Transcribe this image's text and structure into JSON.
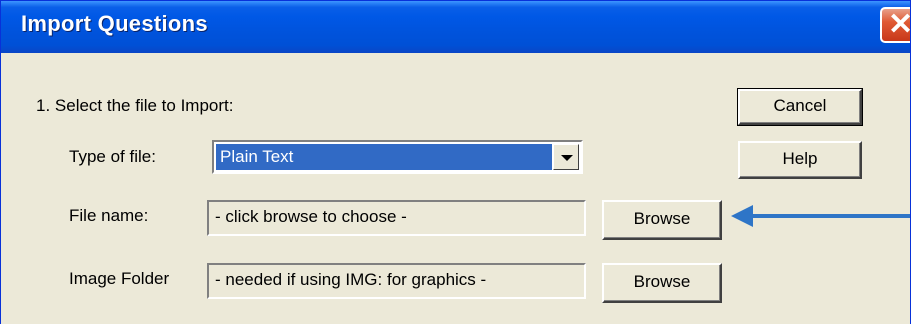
{
  "window": {
    "title": "Import Questions"
  },
  "step": {
    "label": "1.  Select the file to Import:"
  },
  "type_of_file": {
    "label": "Type of file:",
    "value": "Plain Text"
  },
  "file_name": {
    "label": "File name:",
    "value": "- click browse to choose -",
    "browse_label": "Browse"
  },
  "image_folder": {
    "label": "Image Folder",
    "value": "- needed if using IMG: for graphics -",
    "browse_label": "Browse"
  },
  "buttons": {
    "cancel": "Cancel",
    "help": "Help"
  },
  "colors": {
    "titlebar": "#0058e6",
    "dialog_bg": "#ece9d8",
    "selection": "#316ac5",
    "arrow": "#2e75c7",
    "close": "#e05a34"
  },
  "icons": {
    "close": "close-icon",
    "dropdown": "chevron-down-icon",
    "annotation": "arrow-left-icon"
  }
}
